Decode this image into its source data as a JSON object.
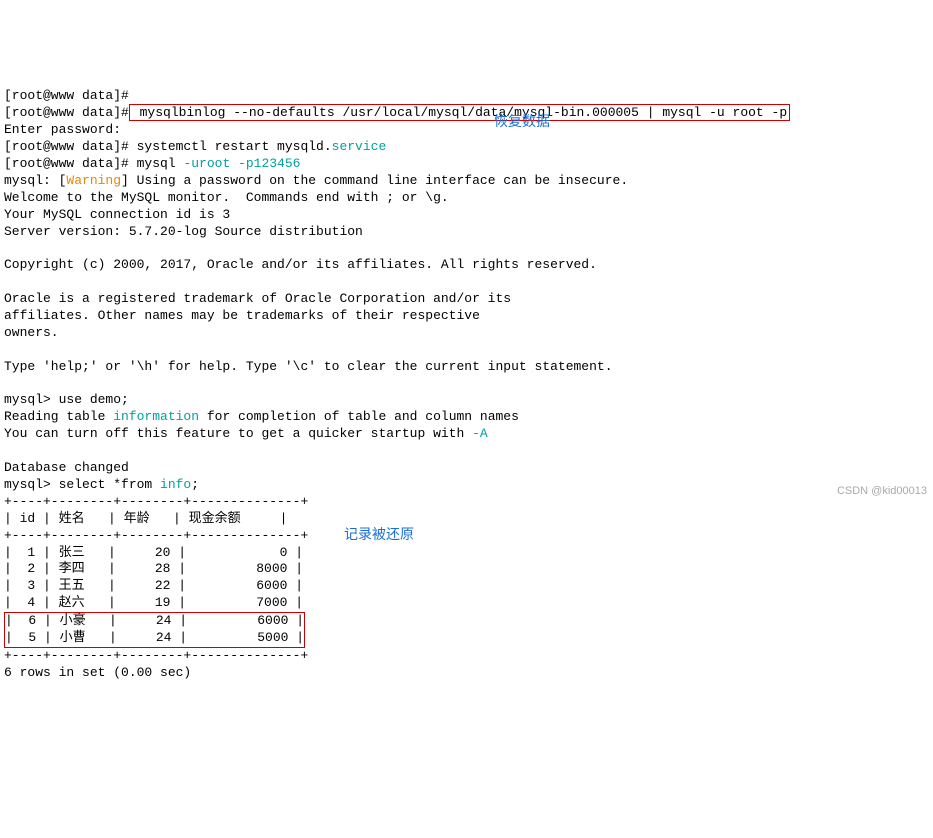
{
  "l0": "[root@www data]#",
  "cmd1": " mysqlbinlog --no-defaults /usr/local/mysql/data/mysql-bin.000005 | mysql -u root -p",
  "l2": "Enter password:",
  "l3a": "[root@www data]# systemctl restart mysqld.",
  "l3b": "service",
  "l4a": "[root@www data]# mysql ",
  "l4b": "-uroot -p123456",
  "l5a": "mysql: [",
  "l5b": "Warning",
  "l5c": "] Using a password on the command line interface can be insecure.",
  "l6": "Welcome to the MySQL monitor.  Commands end with ; or \\g.",
  "l7": "Your MySQL connection id is 3",
  "l8": "Server version: 5.7.20-log Source distribution",
  "l9": "Copyright (c) 2000, 2017, Oracle and/or its affiliates. All rights reserved.",
  "l10": "Oracle is a registered trademark of Oracle Corporation and/or its",
  "l11": "affiliates. Other names may be trademarks of their respective",
  "l12": "owners.",
  "l13": "Type 'help;' or '\\h' for help. Type '\\c' to clear the current input statement.",
  "l14": "mysql> use demo;",
  "l15a": "Reading table ",
  "l15b": "information",
  "l15c": " for completion of table and column names",
  "l16a": "You can turn off this feature to get a quicker startup with ",
  "l16b": "-A",
  "l17": "Database changed",
  "l18a": "mysql> select *from ",
  "l18b": "info",
  "l18c": ";",
  "tb_sep": "+----+--------+--------+--------------+",
  "tb_hdr": "| id | 姓名   | 年龄   | 现金余额     |",
  "tb_r1": "|  1 | 张三   |     20 |            0 |",
  "tb_r2": "|  2 | 李四   |     28 |         8000 |",
  "tb_r3": "|  3 | 王五   |     22 |         6000 |",
  "tb_r4": "|  4 | 赵六   |     19 |         7000 |",
  "tb_r5": "|  6 | 小豪   |     24 |         6000 |",
  "tb_r6": "|  5 | 小曹   |     24 |         5000 |",
  "l_end": "6 rows in set (0.00 sec)",
  "ann1": "恢复数据",
  "ann2": "记录被还原",
  "footer": "CSDN @kid00013"
}
